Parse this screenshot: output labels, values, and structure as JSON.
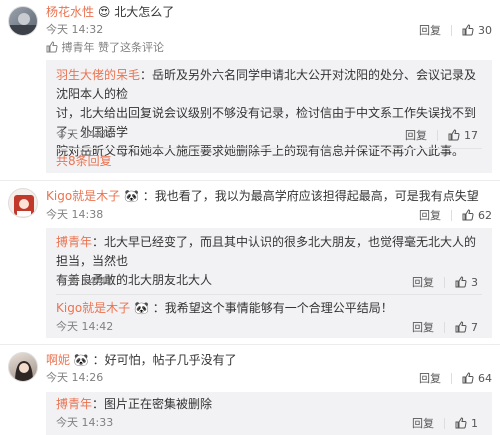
{
  "comments": [
    {
      "user": "杨花水性",
      "badge_icon": "heart-eyes-icon",
      "text": "北大怎么了",
      "time": "今天 14:32",
      "reply_label": "回复",
      "likes": "30",
      "liked_by_user": "搏青年",
      "liked_by_text": " 赞了这条评论",
      "replies": [
        {
          "user": "羽生大佬的呆毛",
          "text_line1": "：岳昕及另外六名同学申请北大公开对沈阳的处分、会议记录及沈阳本人的检",
          "text_line2": "讨，北大给出回复说会议级别不够没有记录，检讨信由于中文系工作失误找不到了，外国语学",
          "text_line3": "院对岳昕父母和她本人施压要求她删除手上的现有信息并保证不再介入此事。",
          "time": "今天 14:38",
          "reply_label": "回复",
          "likes": "17"
        }
      ],
      "more_replies": "共8条回复"
    },
    {
      "user": "Kigo就是木子",
      "badge_icon": "panda-icon",
      "text": "：我也看了，我以为最高学府应该担得起最高，可是我有点失望",
      "time": "今天 14:38",
      "reply_label": "回复",
      "likes": "62",
      "replies": [
        {
          "user": "搏青年",
          "text_line1": "：北大早已经变了，而且其中认识的很多北大朋友，也觉得毫无北大人的担当，当然也",
          "text_line2": "有善良勇敢的北大朋友北大人",
          "time": "今天 14:41",
          "reply_label": "回复",
          "likes": "3"
        },
        {
          "user": "Kigo就是木子",
          "badge_icon": "panda-icon",
          "text_line1": "：我希望这个事情能够有一个合理公平结局！",
          "time": "今天 14:42",
          "reply_label": "回复",
          "likes": "7"
        }
      ]
    },
    {
      "user": "啊妮",
      "badge_icon": "panda-icon",
      "text": "：好可怕，帖子几乎没有了",
      "time": "今天 14:26",
      "reply_label": "回复",
      "likes": "64",
      "replies": [
        {
          "user": "搏青年",
          "text_line1": "：图片正在密集被删除",
          "time": "今天 14:33",
          "reply_label": "回复",
          "likes": "1"
        }
      ]
    }
  ],
  "colors": {
    "username": "#eb7350",
    "reply_bg": "#f2f2f5"
  }
}
